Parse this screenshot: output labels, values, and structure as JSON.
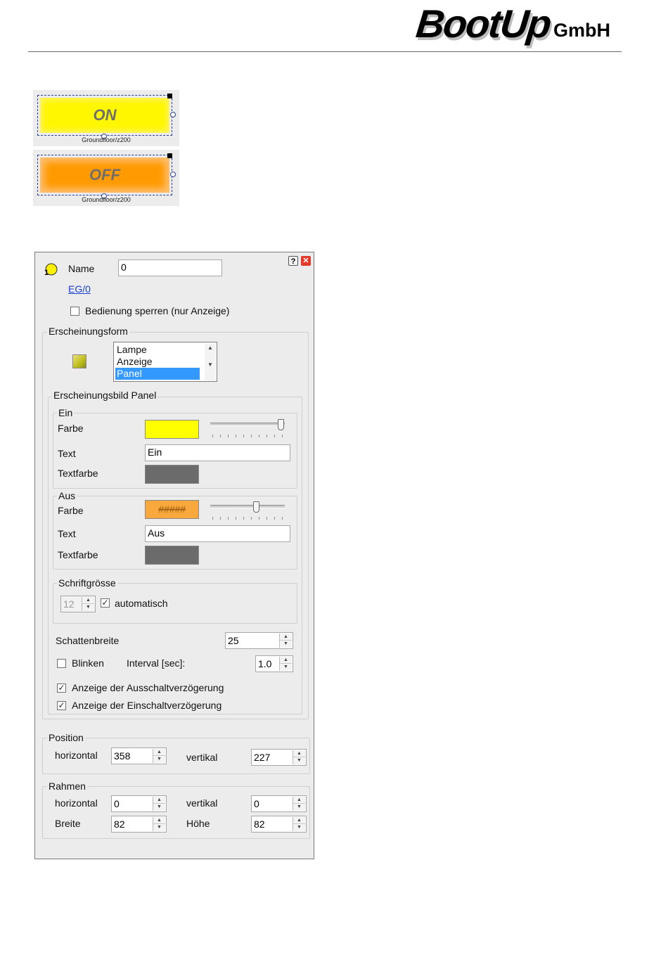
{
  "header": {
    "logo_main": "BootUp",
    "logo_sub": "GmbH"
  },
  "previews": [
    {
      "label": "ON",
      "caption": "Groundfloor/z200",
      "color": "#fff700"
    },
    {
      "label": "OFF",
      "caption": "Groundfloor/z200",
      "color": "#ff9a00"
    }
  ],
  "dialog": {
    "icons": {
      "help": "help-icon",
      "close": "close-icon",
      "object": "lamp-icon"
    },
    "name_label": "Name",
    "name_value": "0",
    "address_link": "EG/0",
    "lock_label": "Bedienung sperren (nur Anzeige)",
    "lock_checked": false,
    "appearance": {
      "title": "Erscheinungsform",
      "options": [
        "Lampe",
        "Anzeige",
        "Panel"
      ],
      "selected": "Panel"
    },
    "panel": {
      "title": "Erscheinungsbild Panel",
      "on": {
        "title": "Ein",
        "color_label": "Farbe",
        "color": "#ffff00",
        "text_label": "Text",
        "text_value": "Ein",
        "textcolor_label": "Textfarbe",
        "textcolor": "#6b6b6b",
        "transparency": 1.0
      },
      "off": {
        "title": "Aus",
        "color_label": "Farbe",
        "color": "#f8a83c",
        "swatch_text": "#####",
        "text_label": "Text",
        "text_value": "Aus",
        "textcolor_label": "Textfarbe",
        "textcolor": "#6b6b6b",
        "transparency": 0.65
      },
      "font": {
        "title": "Schriftgrösse",
        "size": "12",
        "auto_label": "automatisch",
        "auto_checked": true
      },
      "shadow_label": "Schattenbreite",
      "shadow_value": "25",
      "blink_label": "Blinken",
      "blink_checked": false,
      "interval_label": "Interval [sec]:",
      "interval_value": "1.0",
      "off_delay_label": "Anzeige der Ausschaltverzögerung",
      "off_delay_checked": true,
      "on_delay_label": "Anzeige der Einschaltverzögerung",
      "on_delay_checked": true
    },
    "position": {
      "title": "Position",
      "h_label": "horizontal",
      "h_value": "358",
      "v_label": "vertikal",
      "v_value": "227"
    },
    "frame": {
      "title": "Rahmen",
      "h_label": "horizontal",
      "h_value": "0",
      "v_label": "vertikal",
      "v_value": "0",
      "w_label": "Breite",
      "w_value": "82",
      "hgt_label": "Höhe",
      "hgt_value": "82"
    }
  }
}
